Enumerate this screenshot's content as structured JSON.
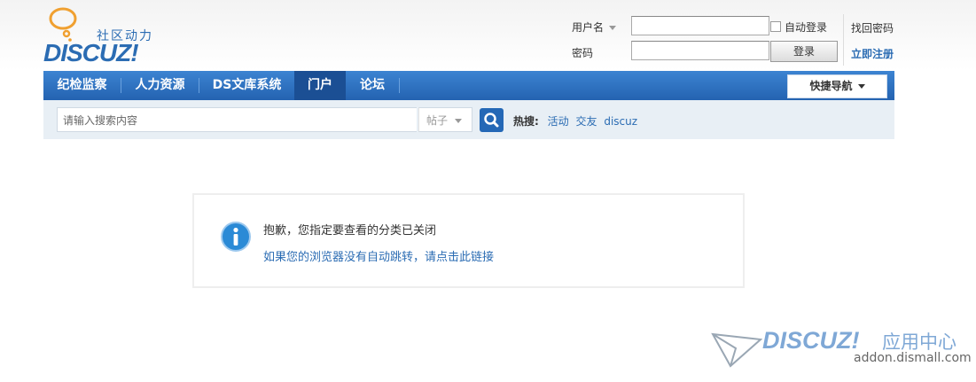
{
  "header": {
    "logo": {
      "tagline": "社区动力",
      "word": "DISCUZ!"
    }
  },
  "login": {
    "username_label": "用户名",
    "username_value": "",
    "password_label": "密码",
    "password_value": "",
    "auto_login_label": "自动登录",
    "login_button": "登录",
    "forgot_password": "找回密码",
    "register": "立即注册"
  },
  "nav": {
    "items": [
      {
        "label": "纪检监察"
      },
      {
        "label": "人力资源"
      },
      {
        "label": "DS文库系统"
      },
      {
        "label": "门户",
        "active": true
      },
      {
        "label": "论坛"
      }
    ],
    "quick_nav": "快捷导航"
  },
  "search": {
    "placeholder": "请输入搜索内容",
    "type_selected": "帖子",
    "hot_label": "热搜:",
    "hot_keywords": [
      "活动",
      "交友",
      "discuz"
    ]
  },
  "message": {
    "title": "抱歉，您指定要查看的分类已关闭",
    "redirect_link": "如果您的浏览器没有自动跳转，请点击此链接"
  },
  "watermark": {
    "word": "DISCUZ!",
    "cn": "应用中心",
    "url": "addon.dismall.com"
  },
  "colors": {
    "brand_blue": "#2b6cb3",
    "nav_active": "#1b4f94",
    "logo_bubble": "#f0a030"
  }
}
